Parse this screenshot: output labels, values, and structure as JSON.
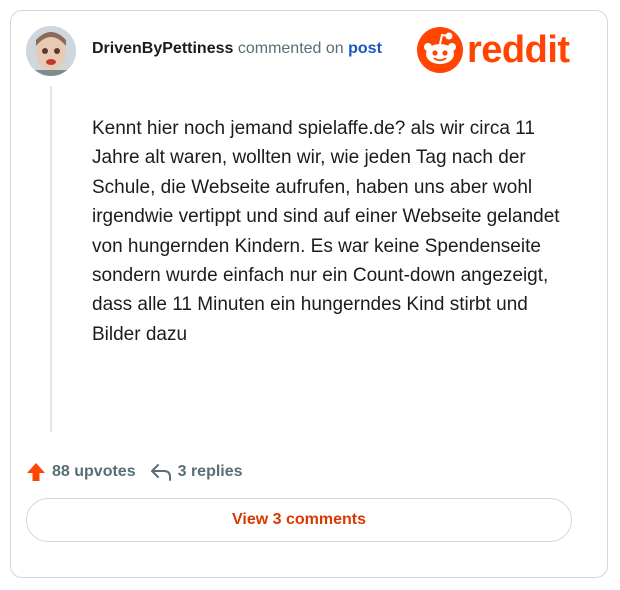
{
  "comment": {
    "username": "DrivenByPettiness",
    "action_text": " commented on ",
    "post_link": "post",
    "body": "Kennt hier noch jemand spielaffe.de? als wir circa 11 Jahre alt waren, wollten wir, wie jeden Tag nach der Schule, die Webseite aufrufen, haben uns aber wohl irgendwie vertippt und sind auf einer Webseite gelandet von hungernden Kindern. Es war keine Spendenseite sondern wurde einfach nur ein Count-down angezeigt, dass alle 11 Minuten ein hungerndes Kind stirbt und Bilder dazu"
  },
  "brand": {
    "name": "reddit",
    "color": "#ff4500",
    "icon": "reddit-alien-logo"
  },
  "actions": {
    "upvotes_label": "88 upvotes",
    "upvote_icon": "arrow-up-icon",
    "replies_label": "3 replies",
    "reply_icon": "reply-arrow-icon"
  },
  "view_comments_label": "View 3 comments",
  "colors": {
    "link": "#1a55c6",
    "accent": "#ff4500",
    "button_text": "#d93900",
    "muted": "#576f76"
  }
}
